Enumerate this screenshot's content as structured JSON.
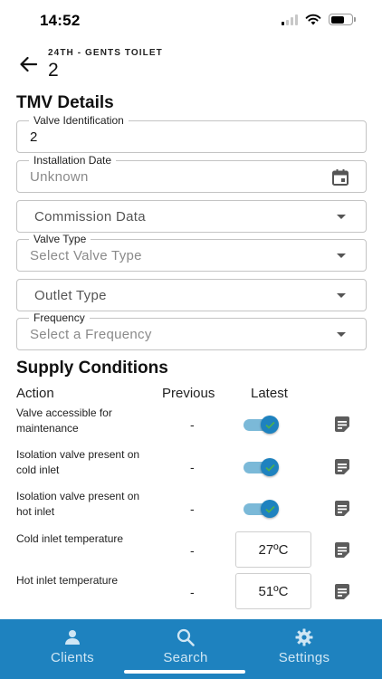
{
  "status_bar": {
    "time": "14:52"
  },
  "header": {
    "subtitle": "24TH - GENTS TOILET",
    "title": "2"
  },
  "tmv_section": {
    "title": "TMV Details"
  },
  "fields": {
    "valve_identification": {
      "label": "Valve Identification",
      "value": "2"
    },
    "installation_date": {
      "label": "Installation Date",
      "placeholder": "Unknown"
    },
    "commission_data": {
      "text": "Commission Data"
    },
    "valve_type": {
      "label": "Valve Type",
      "placeholder": "Select Valve Type"
    },
    "outlet_type": {
      "text": "Outlet Type"
    },
    "frequency": {
      "label": "Frequency",
      "placeholder": "Select a Frequency"
    }
  },
  "supply_section": {
    "title": "Supply Conditions"
  },
  "table": {
    "headers": {
      "action": "Action",
      "previous": "Previous",
      "latest": "Latest"
    },
    "rows": [
      {
        "label": "Valve accessible for maintenance",
        "previous": "-",
        "latest_type": "toggle",
        "toggled": true
      },
      {
        "label": "Isolation valve present on cold inlet",
        "previous": "-",
        "latest_type": "toggle",
        "toggled": true
      },
      {
        "label": "Isolation valve present on hot inlet",
        "previous": "-",
        "latest_type": "toggle",
        "toggled": true
      },
      {
        "label": "Cold inlet temperature",
        "previous": "-",
        "latest_type": "value",
        "latest": "27ºC"
      },
      {
        "label": "Hot inlet temperature",
        "previous": "-",
        "latest_type": "value",
        "latest": "51ºC"
      }
    ]
  },
  "bottom_nav": {
    "items": [
      {
        "label": "Clients",
        "icon": "person-icon"
      },
      {
        "label": "Search",
        "icon": "search-icon"
      },
      {
        "label": "Settings",
        "icon": "gear-icon"
      }
    ]
  },
  "colors": {
    "accent": "#1e82bf",
    "toggle_track": "#7bb9d8",
    "toggle_check": "#4caf50",
    "nav_label": "#cfe6f4"
  }
}
